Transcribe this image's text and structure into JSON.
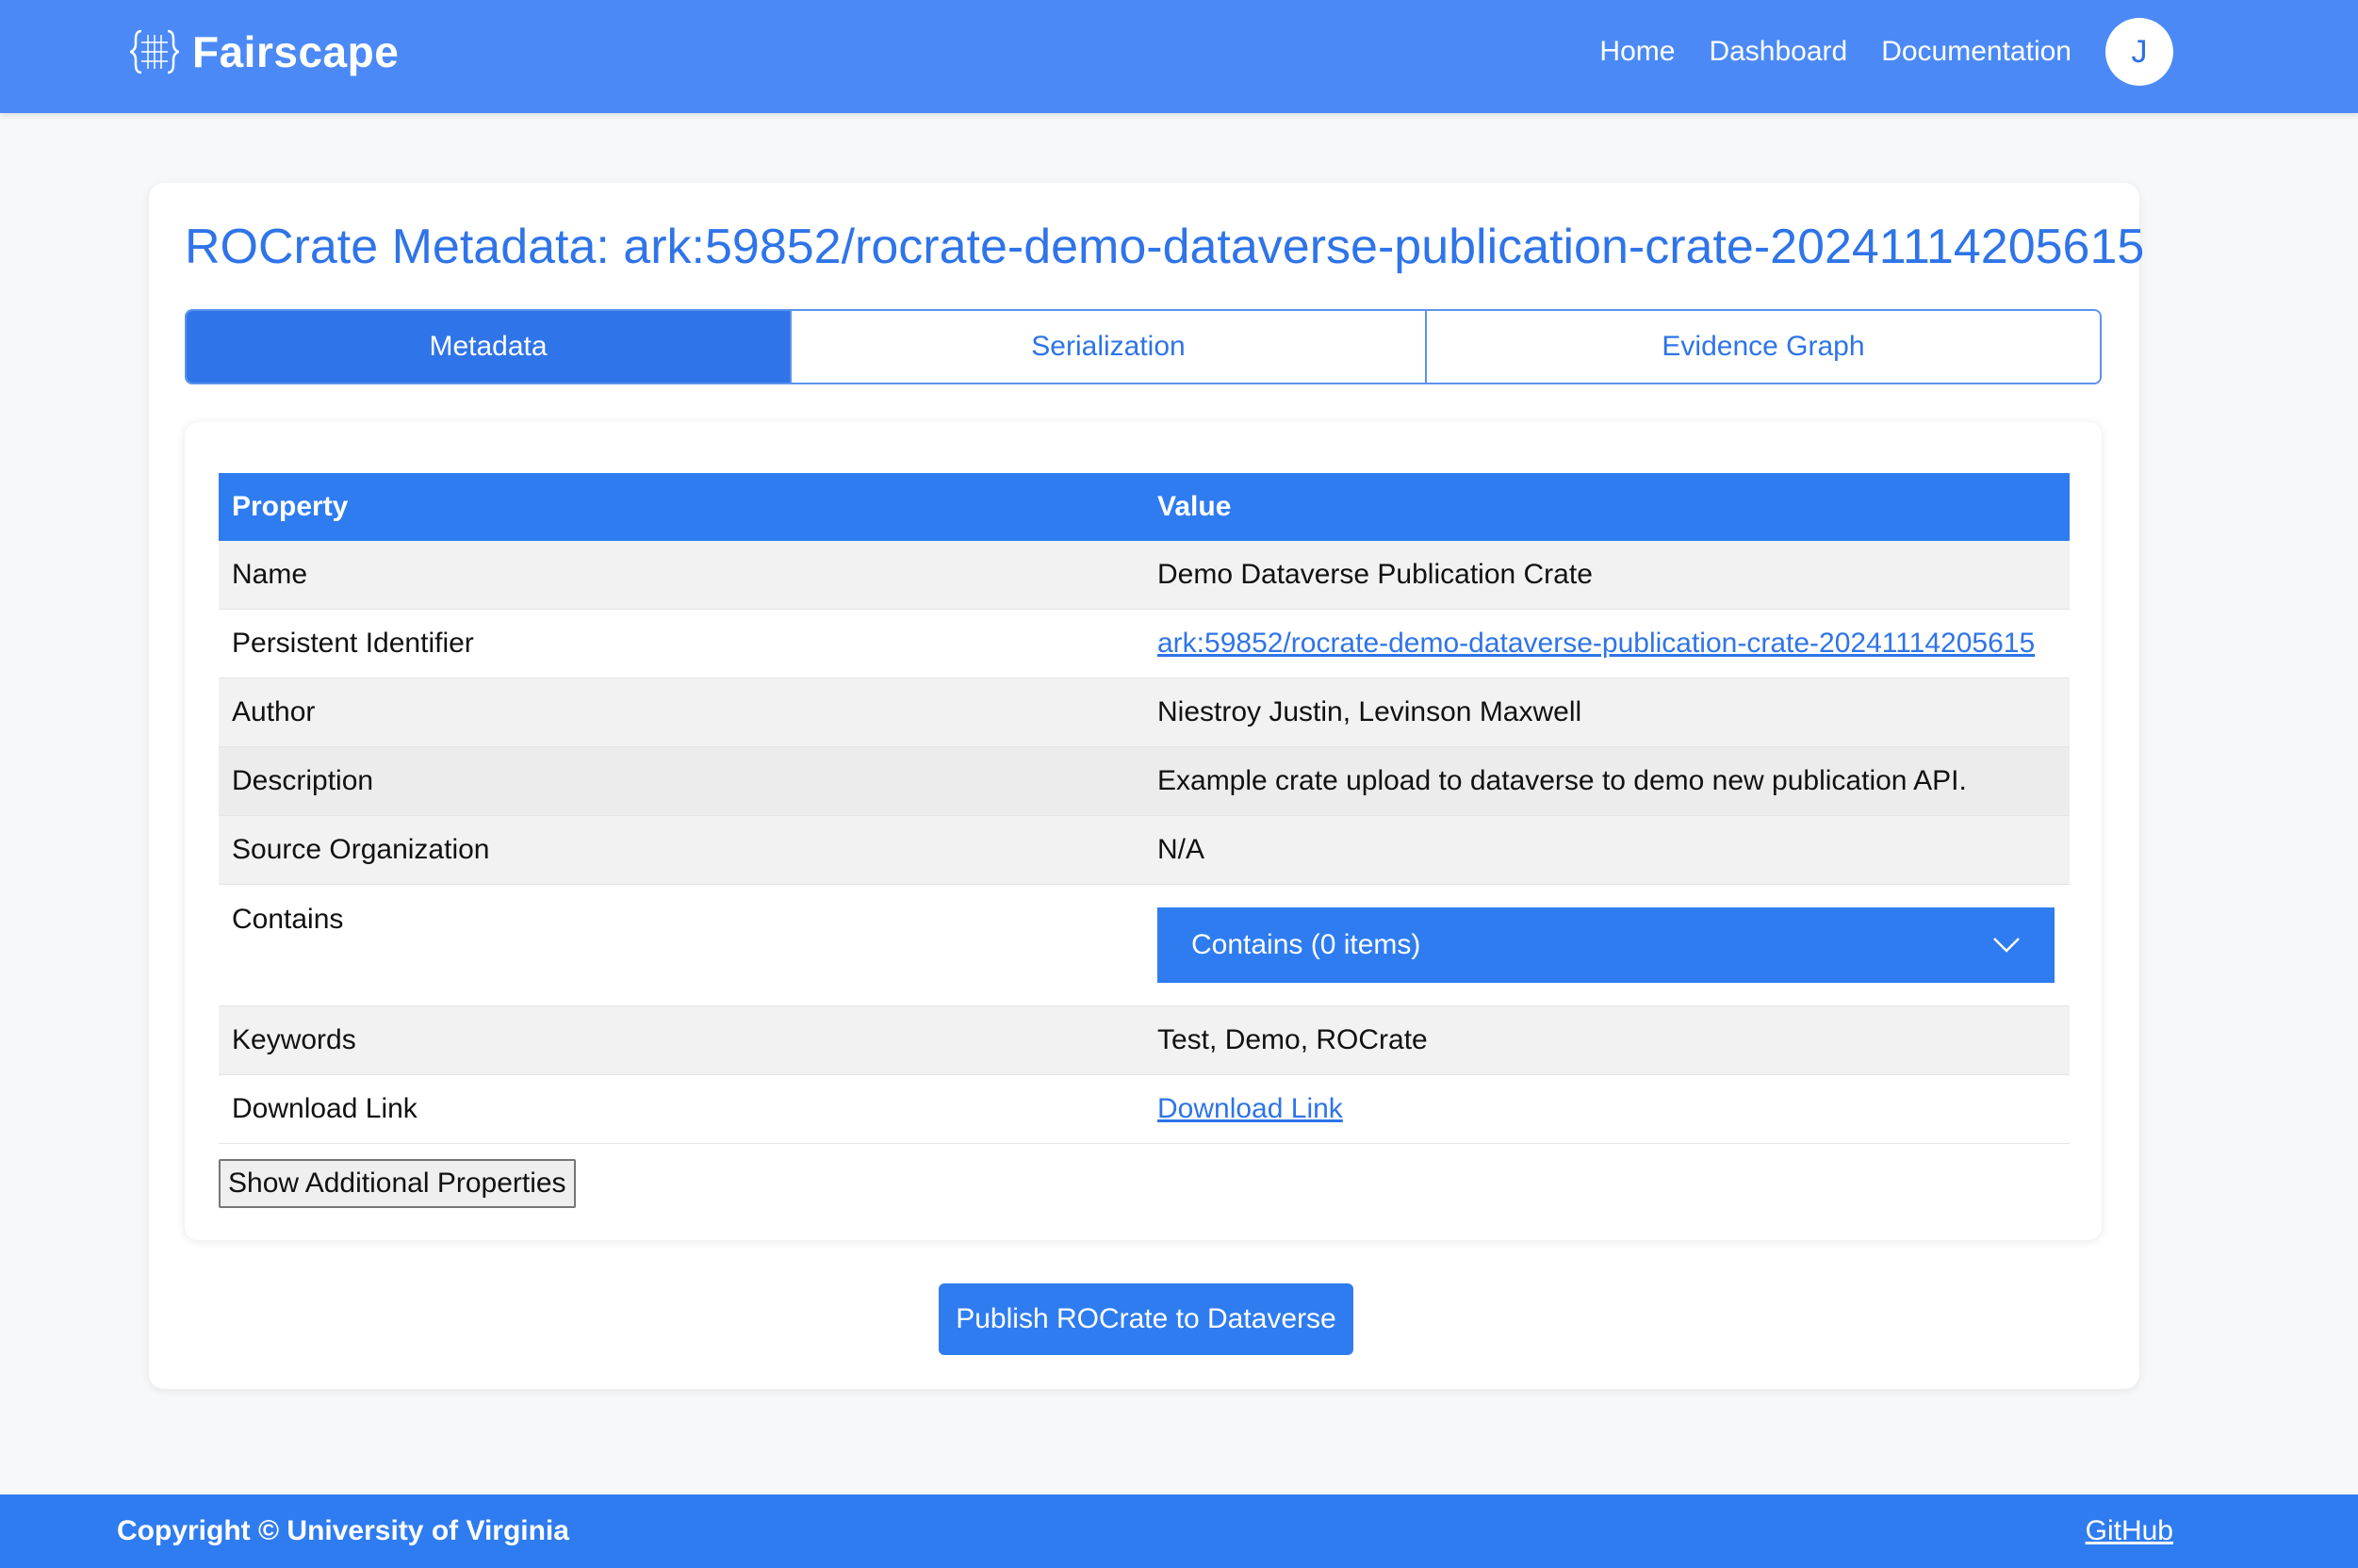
{
  "header": {
    "brand": "Fairscape",
    "brand_icon": "fairscape-grid-logo-icon",
    "nav": [
      "Home",
      "Dashboard",
      "Documentation"
    ],
    "avatar_initial": "J"
  },
  "page": {
    "title": "ROCrate Metadata: ark:59852/rocrate-demo-dataverse-publication-crate-20241114205615",
    "tabs": [
      {
        "label": "Metadata",
        "active": true
      },
      {
        "label": "Serialization",
        "active": false
      },
      {
        "label": "Evidence Graph",
        "active": false
      }
    ]
  },
  "table": {
    "headers": [
      "Property",
      "Value"
    ],
    "rows": [
      {
        "property": "Name",
        "value": "Demo Dataverse Publication Crate"
      },
      {
        "property": "Persistent Identifier",
        "value": "ark:59852/rocrate-demo-dataverse-publication-crate-20241114205615",
        "is_link": true
      },
      {
        "property": "Author",
        "value": "Niestroy Justin, Levinson Maxwell"
      },
      {
        "property": "Description",
        "value": "Example crate upload to dataverse to demo new publication API."
      },
      {
        "property": "Source Organization",
        "value": "N/A"
      },
      {
        "property": "Contains",
        "value": "Contains (0 items)",
        "is_dropdown": true,
        "icon": "chevron-down-icon"
      },
      {
        "property": "Keywords",
        "value": "Test, Demo, ROCrate"
      },
      {
        "property": "Download Link",
        "value": "Download Link",
        "is_link": true
      }
    ]
  },
  "actions": {
    "show_more": "Show Additional Properties",
    "publish": "Publish ROCrate to Dataverse"
  },
  "footer": {
    "copyright": "Copyright © University of Virginia",
    "github": "GitHub"
  },
  "colors": {
    "header_bg": "#4b8af6",
    "primary": "#2f7cf0",
    "title_blue": "#2f74e8",
    "page_bg": "#f7f8fa"
  }
}
